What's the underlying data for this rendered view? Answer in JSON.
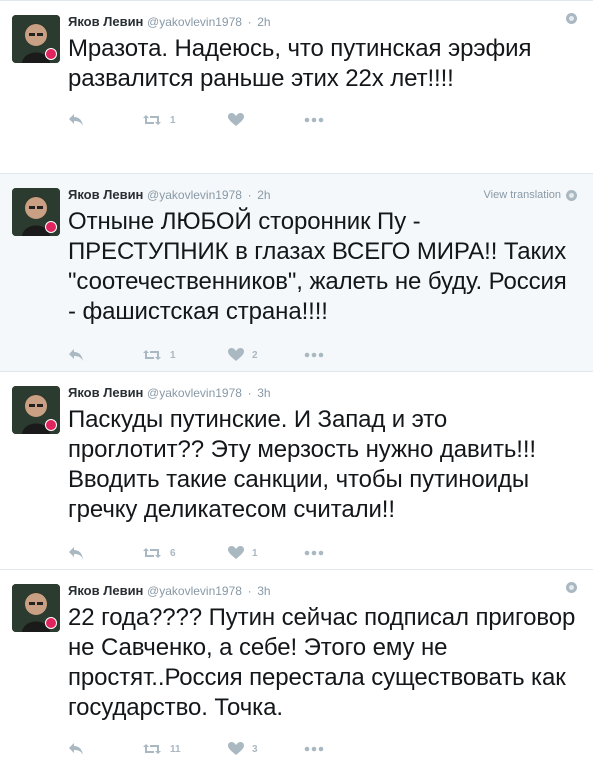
{
  "colors": {
    "accent_like": "#aab8c2",
    "badge": "#e0245e",
    "highlight_bg": "#f5f8fa"
  },
  "tweets": [
    {
      "name": "Яков Левин",
      "handle": "@yakovlevin1978",
      "sep": "·",
      "time": "2h",
      "corner_text": "",
      "text": "Мразота. Надеюсь, что путинская эрэфия развалится раньше этих 22х лет!!!!",
      "retweets": "1",
      "likes": "",
      "highlight": false
    },
    {
      "name": "Яков Левин",
      "handle": "@yakovlevin1978",
      "sep": "·",
      "time": "2h",
      "corner_text": "View translation",
      "text": "Отныне ЛЮБОЙ сторонник Пу - ПРЕСТУПНИК в глазах ВСЕГО МИРА!! Таких \"соотечественников\", жалеть не буду. Россия - фашистская страна!!!!",
      "retweets": "1",
      "likes": "2",
      "highlight": true
    },
    {
      "name": "Яков Левин",
      "handle": "@yakovlevin1978",
      "sep": "·",
      "time": "3h",
      "corner_text": "",
      "text": "Паскуды путинские. И Запад и это проглотит?? Эту мерзость нужно давить!!!Вводить такие санкции, чтобы путиноиды гречку деликатесом считали!!",
      "retweets": "6",
      "likes": "1",
      "highlight": false
    },
    {
      "name": "Яков Левин",
      "handle": "@yakovlevin1978",
      "sep": "·",
      "time": "3h",
      "corner_text": "",
      "text": "22 года???? Путин сейчас подписал приговор не Савченко, а себе! Этого ему не простят..Россия перестала существовать как государство. Точка.",
      "retweets": "11",
      "likes": "3",
      "highlight": false
    }
  ]
}
